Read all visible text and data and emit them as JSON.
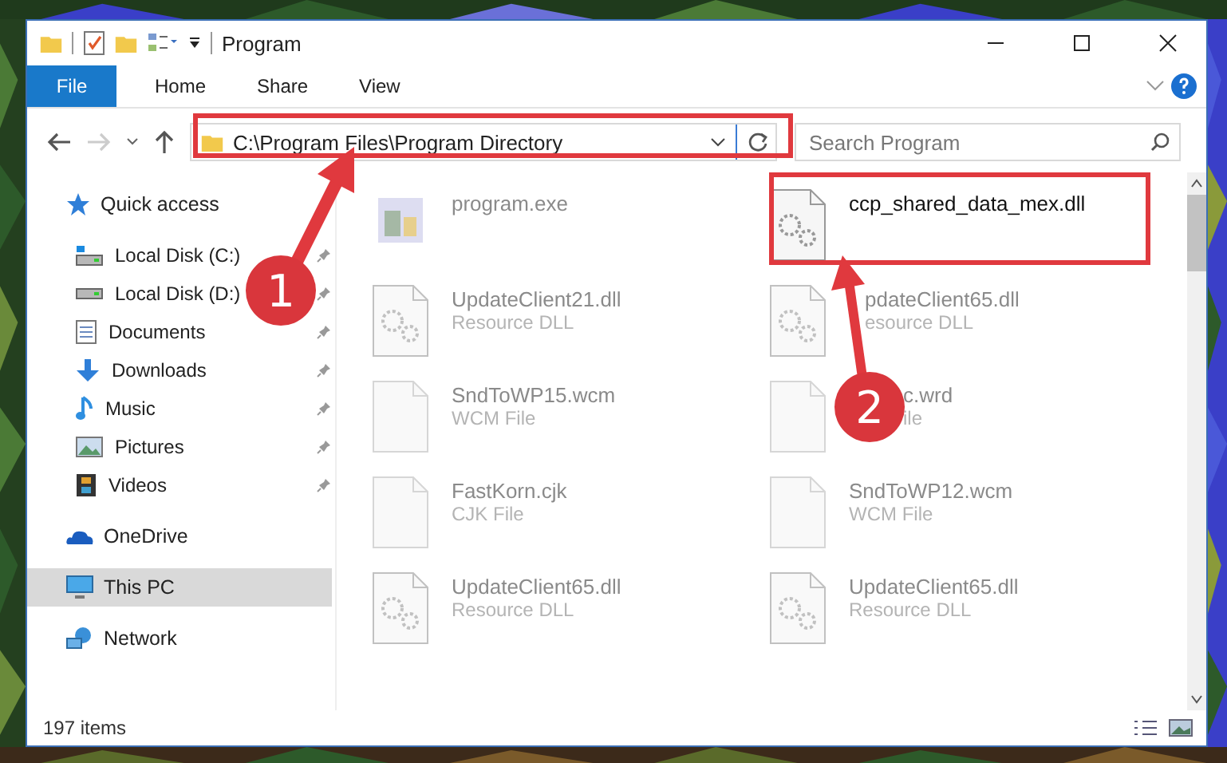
{
  "window": {
    "title": "Program"
  },
  "ribbon_tabs": [
    {
      "label": "File",
      "kind": "menu"
    },
    {
      "label": "Home",
      "kind": "tab"
    },
    {
      "label": "Share",
      "kind": "tab"
    },
    {
      "label": "View",
      "kind": "tab"
    }
  ],
  "navigation": {
    "back_enabled": true,
    "forward_enabled": false
  },
  "address_bar": {
    "path": "C:\\Program Files\\Program Directory"
  },
  "search": {
    "placeholder": "Search Program"
  },
  "sidebar": {
    "items": [
      {
        "label": "Quick access",
        "kind": "star",
        "selected": false,
        "children": [
          {
            "label": "Local Disk (C:)",
            "kind": "system-drive",
            "selected": false,
            "pinned": true
          },
          {
            "label": "Local Disk (D:)",
            "kind": "drive",
            "selected": false,
            "pinned": true
          },
          {
            "label": "Documents",
            "kind": "document",
            "selected": false,
            "pinned": true
          },
          {
            "label": "Downloads",
            "kind": "download",
            "selected": false,
            "pinned": true
          },
          {
            "label": "Music",
            "kind": "music",
            "selected": false,
            "pinned": true
          },
          {
            "label": "Pictures",
            "kind": "picture",
            "selected": false,
            "pinned": true
          },
          {
            "label": "Videos",
            "kind": "video",
            "selected": false,
            "pinned": true
          }
        ]
      },
      {
        "label": "OneDrive",
        "kind": "cloud",
        "selected": false
      },
      {
        "label": "This PC",
        "kind": "computer",
        "selected": true
      },
      {
        "label": "Network",
        "kind": "network",
        "selected": false
      }
    ]
  },
  "files": [
    {
      "name": "program.exe",
      "kind": "exe",
      "blurred": true
    },
    {
      "name": "ccp_shared_data_mex.dll",
      "kind": "dll",
      "blurred": false
    },
    {
      "name": "UpdateClient21.dll",
      "type": "Resource DLL",
      "kind": "dll",
      "blurred": true
    },
    {
      "name": "pdateClient65.dll",
      "type": "esource DLL",
      "kind": "dll",
      "blurred": true
    },
    {
      "name": "SndToWP15.wcm",
      "type": "WCM File",
      "kind": "blank",
      "blurred": true
    },
    {
      "name": "c.wrd",
      "type": "ile",
      "kind": "blank",
      "blurred": true
    },
    {
      "name": "FastKorn.cjk",
      "type": "CJK File",
      "kind": "blank",
      "blurred": true
    },
    {
      "name": "SndToWP12.wcm",
      "type": "WCM File",
      "kind": "blank",
      "blurred": true
    },
    {
      "name": "UpdateClient65.dll",
      "type": "Resource DLL",
      "kind": "dll",
      "blurred": true
    },
    {
      "name": "UpdateClient65.dll",
      "type": "Resource DLL",
      "kind": "dll",
      "blurred": true
    }
  ],
  "status_bar": {
    "item_count": "197 items"
  },
  "annotations": [
    {
      "number": "1"
    },
    {
      "number": "2"
    }
  ]
}
